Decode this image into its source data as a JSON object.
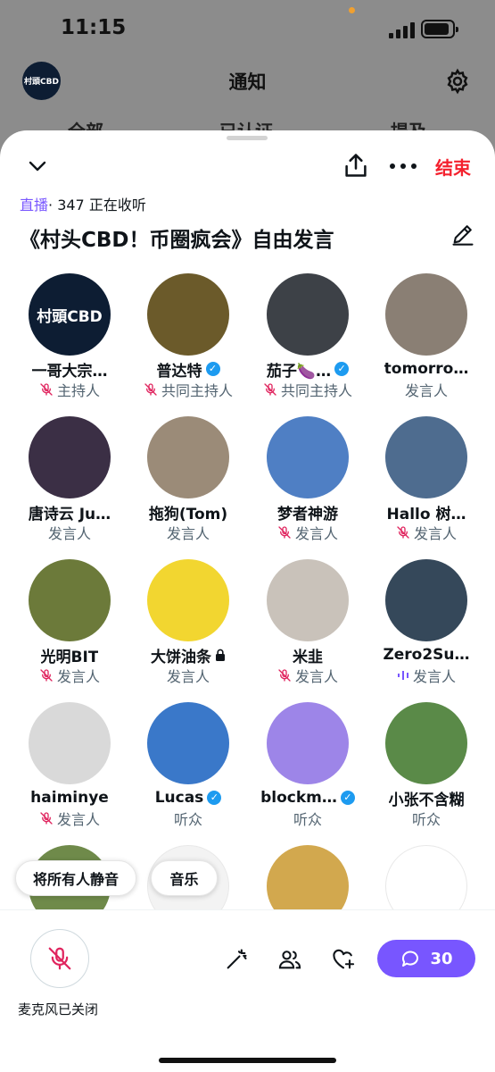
{
  "status_bar": {
    "time": "11:15"
  },
  "background": {
    "logo_text": "村頭CBD",
    "title": "通知",
    "tabs": [
      "全部",
      "已认证",
      "提及"
    ]
  },
  "space": {
    "live_label": "直播",
    "listening": "· 347 正在收听",
    "title": "《村头CBD！币圈疯会》自由发言",
    "end_label": "结束"
  },
  "participants": [
    {
      "name": "一哥大宗…",
      "role": "主持人",
      "mic_off": true,
      "verified": false,
      "avatar_text": "村頭CBD",
      "avatar_color": "#0d1d33"
    },
    {
      "name": "普达特",
      "role": "共同主持人",
      "mic_off": true,
      "verified": true,
      "avatar_text": "",
      "avatar_color": "#6b5a2a"
    },
    {
      "name": "茄子🍆…",
      "role": "共同主持人",
      "mic_off": true,
      "verified": true,
      "avatar_text": "",
      "avatar_color": "#3d4147"
    },
    {
      "name": "tomorro…",
      "role": "发言人",
      "mic_off": false,
      "verified": false,
      "avatar_text": "",
      "avatar_color": "#8a7f74"
    },
    {
      "name": "唐诗云 Ju…",
      "role": "发言人",
      "mic_off": false,
      "verified": false,
      "avatar_text": "",
      "avatar_color": "#3b2f45"
    },
    {
      "name": "拖狗(Tom)",
      "role": "发言人",
      "mic_off": false,
      "verified": false,
      "avatar_text": "",
      "avatar_color": "#9b8b78"
    },
    {
      "name": "梦者神游",
      "role": "发言人",
      "mic_off": true,
      "verified": false,
      "avatar_text": "",
      "avatar_color": "#4f7fc4"
    },
    {
      "name": "Hallo 树…",
      "role": "发言人",
      "mic_off": true,
      "verified": false,
      "avatar_text": "",
      "avatar_color": "#4e6c8f"
    },
    {
      "name": "光明BIT",
      "role": "发言人",
      "mic_off": true,
      "verified": false,
      "avatar_text": "",
      "avatar_color": "#6c7a3a"
    },
    {
      "name": "大饼油条",
      "role": "发言人",
      "mic_off": false,
      "verified": false,
      "locked": true,
      "avatar_text": "",
      "avatar_color": "#f2d630"
    },
    {
      "name": "米韭",
      "role": "发言人",
      "mic_off": true,
      "verified": false,
      "avatar_text": "",
      "avatar_color": "#c9c2ba"
    },
    {
      "name": "Zero2Su…",
      "role": "发言人",
      "mic_off": false,
      "speaking": true,
      "verified": false,
      "avatar_text": "",
      "avatar_color": "#35485a"
    },
    {
      "name": "haiminye",
      "role": "发言人",
      "mic_off": true,
      "verified": false,
      "avatar_text": "",
      "avatar_color": "#d9d9d9"
    },
    {
      "name": "Lucas",
      "role": "听众",
      "mic_off": false,
      "verified": true,
      "avatar_text": "",
      "avatar_color": "#3a78c9"
    },
    {
      "name": "blockm…",
      "role": "听众",
      "mic_off": false,
      "verified": true,
      "avatar_text": "",
      "avatar_color": "#9d85e8"
    },
    {
      "name": "小张不含糊",
      "role": "听众",
      "mic_off": false,
      "verified": false,
      "avatar_text": "",
      "avatar_color": "#5a8a48"
    },
    {
      "name": "",
      "role": "",
      "mic_off": false,
      "verified": false,
      "avatar_text": "",
      "avatar_color": "#6f8a4a"
    },
    {
      "name": "",
      "role": "",
      "mic_off": false,
      "verified": false,
      "avatar_text": "",
      "avatar_color": "#f3f3f3"
    },
    {
      "name": "",
      "role": "",
      "mic_off": false,
      "verified": false,
      "avatar_text": "",
      "avatar_color": "#d2a84e"
    },
    {
      "name": "",
      "role": "",
      "mic_off": false,
      "verified": false,
      "avatar_text": "",
      "avatar_color": "#ffffff"
    }
  ],
  "chips": {
    "mute_all": "将所有人静音",
    "music": "音乐"
  },
  "bottom_bar": {
    "mic_status": "麦克风已关闭",
    "comment_count": "30"
  },
  "colors": {
    "accent": "#7856ff",
    "end": "#f4212e",
    "mic_off": "#e0245e",
    "verified": "#1d9bf0"
  }
}
